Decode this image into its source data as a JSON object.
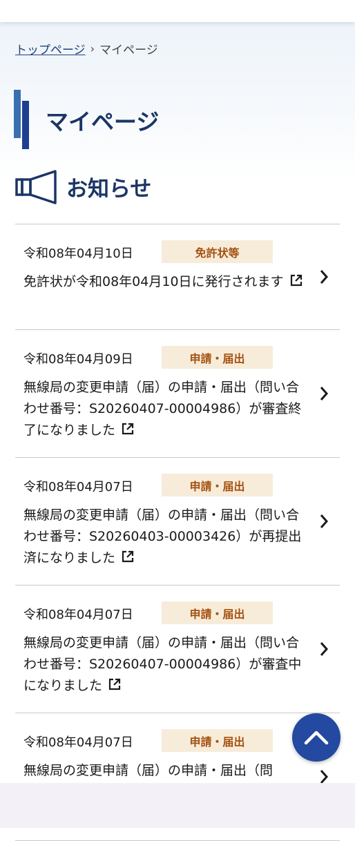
{
  "breadcrumb": {
    "home": "トップページ",
    "separator": "›",
    "current": "マイページ"
  },
  "page": {
    "title": "マイページ"
  },
  "section": {
    "title": "お知らせ",
    "icon": "megaphone-icon"
  },
  "news": [
    {
      "date": "令和08年04月10日",
      "category": "免許状等",
      "text": "免許状が令和08年04月10日に発行されます"
    },
    {
      "date": "令和08年04月09日",
      "category": "申請・届出",
      "text": "無線局の変更申請（届）の申請・届出（問い合わせ番号：S20260407-00004986）が審査終了になりました"
    },
    {
      "date": "令和08年04月07日",
      "category": "申請・届出",
      "text": "無線局の変更申請（届）の申請・届出（問い合わせ番号：S20260403-00003426）が再提出済になりました"
    },
    {
      "date": "令和08年04月07日",
      "category": "申請・届出",
      "text": "無線局の変更申請（届）の申請・届出（問い合わせ番号：S20260407-00004986）が審査中になりました"
    },
    {
      "date": "令和08年04月07日",
      "category": "申請・届出",
      "text": "無線局の変更申請（届）の申請・届出（問"
    }
  ],
  "colors": {
    "primary": "#1b3566",
    "accent_bar_light": "#3a6fb0",
    "accent_bar_dark": "#1e3f8f",
    "badge_bg": "#f7ecda",
    "badge_text": "#a4500e",
    "pagetop_bg": "#2349a0"
  }
}
